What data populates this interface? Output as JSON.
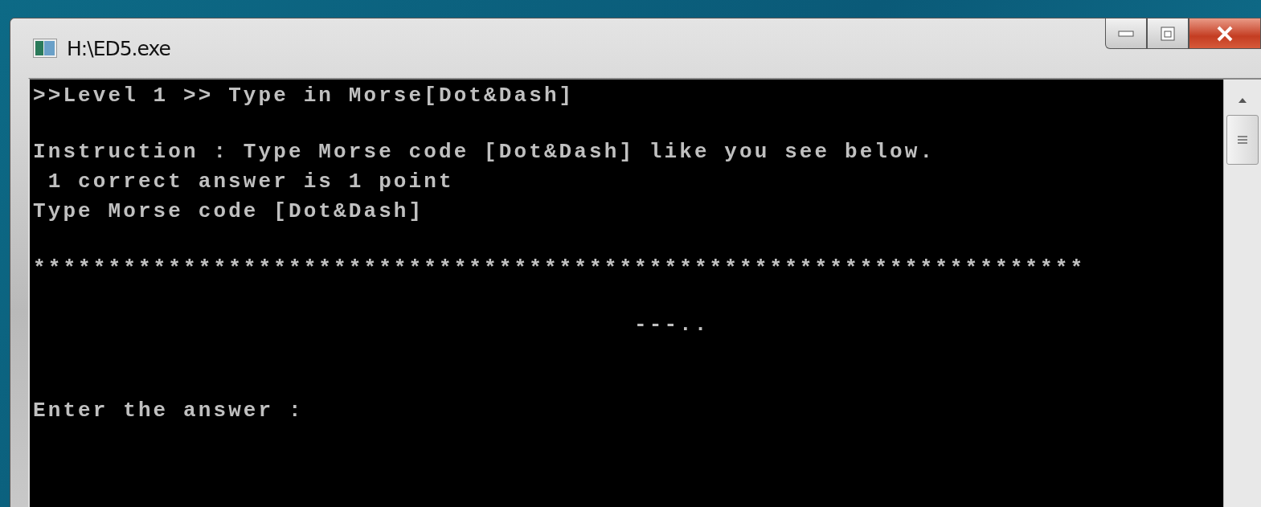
{
  "window": {
    "title": "H:\\ED5.exe"
  },
  "console": {
    "heading": ">>Level 1 >> Type in Morse[Dot&Dash]",
    "instructions": [
      {
        "text": "Instruction : Type Morse code [Dot&Dash] like you see below.",
        "indented": false
      },
      {
        "text": "1 correct answer is 1 point",
        "indented": true
      },
      {
        "text": "Type Morse code [Dot&Dash]",
        "indented": false
      }
    ],
    "separator": "**********************************************************************",
    "morse_code": "---..",
    "prompt": "Enter the answer :"
  }
}
